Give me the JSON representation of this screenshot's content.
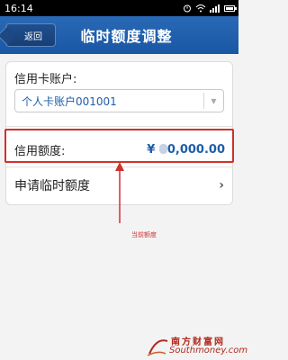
{
  "status_bar": {
    "time": "16:14"
  },
  "header": {
    "back_label": "返回",
    "title": "临时额度调整"
  },
  "card": {
    "account_label": "信用卡账户:",
    "account_value": "个人卡账户001001",
    "credit_label": "信用额度:",
    "credit_value": "¥ ",
    "credit_amount_suffix": "0,000.00",
    "apply_label": "申请临时额度"
  },
  "annotation": {
    "text": "当前额度"
  },
  "watermark": {
    "top": "南方财富网",
    "bottom": "Southmoney.com"
  },
  "colors": {
    "header_blue": "#1f5fa9",
    "value_blue": "#1e5ea8",
    "annotation_red": "#d0312d"
  }
}
